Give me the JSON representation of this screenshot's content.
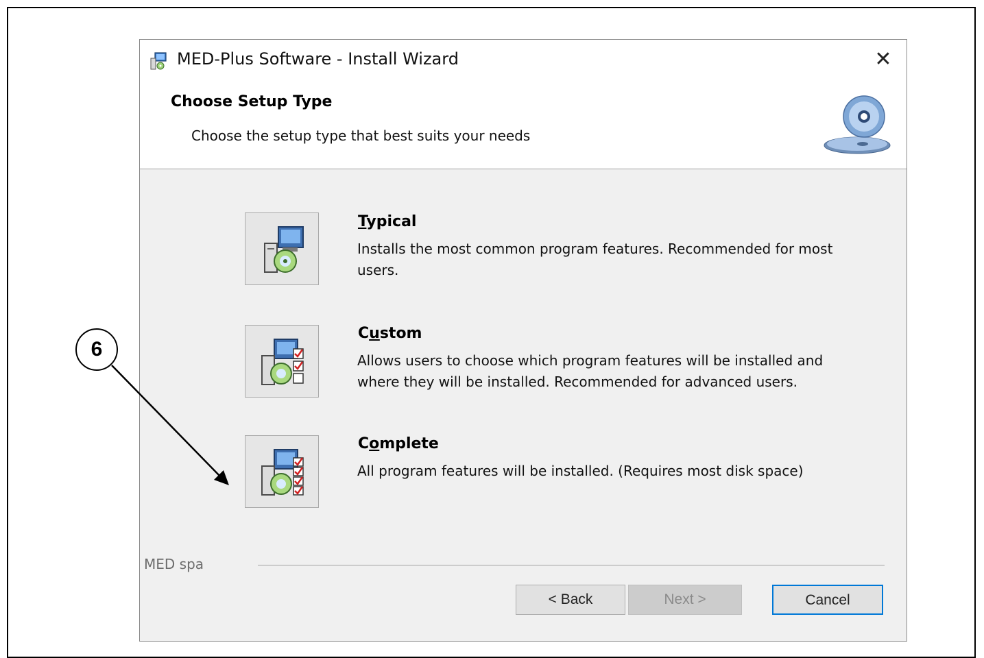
{
  "window": {
    "title": "MED-Plus Software - Install Wizard",
    "close_glyph": "✕"
  },
  "header": {
    "title": "Choose Setup Type",
    "subtitle": "Choose the setup type that best suits your needs",
    "icon": "cd-icon"
  },
  "options": [
    {
      "title_before": "",
      "title_mnemonic": "T",
      "title_after": "ypical",
      "description": "Installs the most common program features. Recommended for most users.",
      "icon": "typical-setup-icon"
    },
    {
      "title_before": "C",
      "title_mnemonic": "u",
      "title_after": "stom",
      "description": "Allows users to choose which program features will be installed and where they will be installed. Recommended for advanced users.",
      "icon": "custom-setup-icon"
    },
    {
      "title_before": "C",
      "title_mnemonic": "o",
      "title_after": "mplete",
      "description": "All program features will be installed.  (Requires most disk space)",
      "icon": "complete-setup-icon"
    }
  ],
  "footer": {
    "brand": "MED spa",
    "back_label": "< Back",
    "next_label": "Next >",
    "cancel_label": "Cancel"
  },
  "annotation": {
    "callout_number": "6"
  },
  "colors": {
    "dialog_bg": "#f0f0f0",
    "header_bg": "#ffffff",
    "focus_border": "#0078d7",
    "disabled_text": "#8b8b8b"
  }
}
